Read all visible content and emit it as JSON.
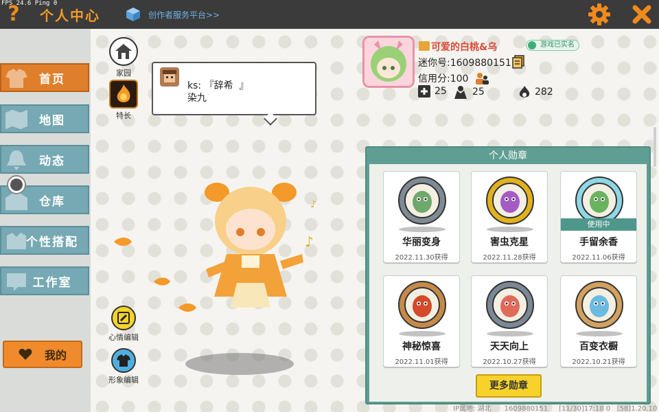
{
  "topbar": {
    "fps_text": "FPS 24.6  Ping 0",
    "help_label": "?",
    "title": "个人中心",
    "creator_link": "创作者服务平台>>"
  },
  "sidebar": {
    "items": [
      {
        "label": "首页",
        "icon": "shirt-icon",
        "active": true
      },
      {
        "label": "地图",
        "icon": "map-icon",
        "active": false
      },
      {
        "label": "动态",
        "icon": "bell-icon",
        "active": false
      },
      {
        "label": "仓库",
        "icon": "warehouse-icon",
        "active": false
      },
      {
        "label": "个性搭配",
        "icon": "outfit-icon",
        "active": false
      },
      {
        "label": "工作室",
        "icon": "studio-icon",
        "active": false
      }
    ],
    "my_button": "我的"
  },
  "quick": {
    "home": "家园",
    "talent": "特长",
    "mood_edit": "心情编辑",
    "look_edit": "形象编辑"
  },
  "bubble": {
    "text": "ks: 『辞希  』\n染九"
  },
  "profile": {
    "username": "可爱的白桃&乌",
    "realname_badge": "游戏已实名",
    "mini_id": "迷你号:1609880151",
    "credit": "信用分:100",
    "stats": {
      "friends": "25",
      "fans": "25",
      "popularity": "282"
    }
  },
  "badges": {
    "title": "个人勋章",
    "items": [
      {
        "name": "华丽变身",
        "date": "2022.11.30获得",
        "in_use": false,
        "ring": "#7f8a94",
        "face": "#6ea86a"
      },
      {
        "name": "害虫克星",
        "date": "2022.11.28获得",
        "in_use": false,
        "ring": "#e2b11e",
        "face": "#a55bc4"
      },
      {
        "name": "手留余香",
        "date": "2022.11.06获得",
        "in_use": true,
        "in_use_label": "使用中",
        "ring": "#8fd6e6",
        "face": "#6ab35f"
      },
      {
        "name": "神秘惊喜",
        "date": "2022.11.01获得",
        "in_use": false,
        "ring": "#c58a4a",
        "face": "#d44a2a"
      },
      {
        "name": "天天向上",
        "date": "2022.10.27获得",
        "in_use": false,
        "ring": "#7b8794",
        "face": "#e06a5a"
      },
      {
        "name": "百变衣橱",
        "date": "2022.10.21获得",
        "in_use": false,
        "ring": "#d2a160",
        "face": "#6bbbe0"
      }
    ],
    "more_label": "更多勋章"
  },
  "footer": {
    "ip": "IP属地: 湖北",
    "id": "1609880151",
    "time": "[11/30]17:18 0",
    "version": "[58]1.20.10"
  },
  "colors": {
    "accent_orange": "#e07f2b",
    "nav_teal": "#76a9b4",
    "panel_green": "#5f9e93"
  }
}
